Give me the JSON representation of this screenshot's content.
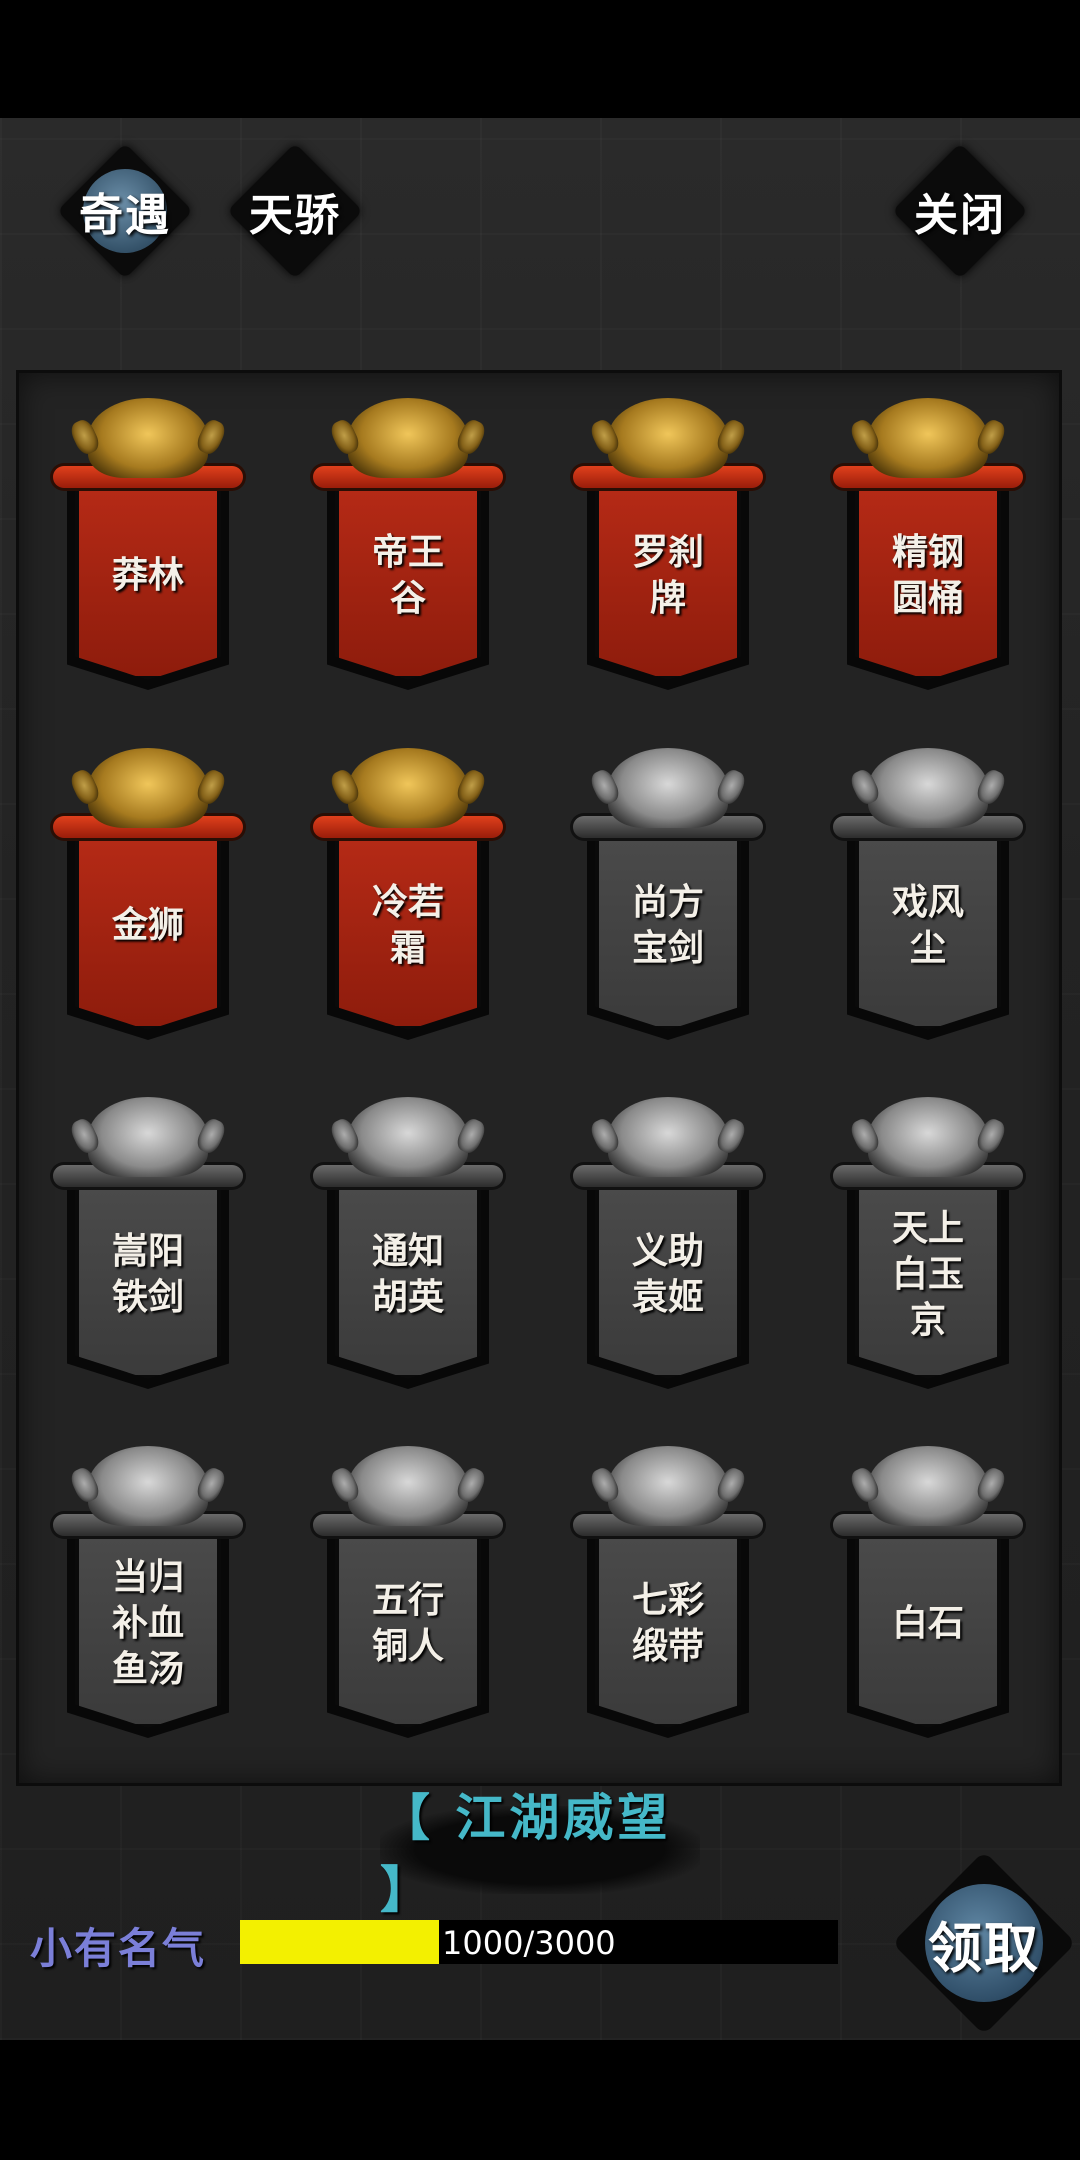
{
  "tabs": [
    {
      "label": "奇遇",
      "active": true
    },
    {
      "label": "天骄",
      "active": false
    }
  ],
  "close_label": "关闭",
  "items": [
    {
      "label": "莽林",
      "state": "unlocked"
    },
    {
      "label": "帝王谷",
      "state": "unlocked"
    },
    {
      "label": "罗刹牌",
      "state": "unlocked"
    },
    {
      "label": "精钢圆桶",
      "state": "unlocked"
    },
    {
      "label": "金狮",
      "state": "unlocked"
    },
    {
      "label": "冷若霜",
      "state": "unlocked"
    },
    {
      "label": "尚方宝剑",
      "state": "locked"
    },
    {
      "label": "戏风尘",
      "state": "locked"
    },
    {
      "label": "嵩阳铁剑",
      "state": "locked"
    },
    {
      "label": "通知胡英",
      "state": "locked"
    },
    {
      "label": "义助袁姬",
      "state": "locked"
    },
    {
      "label": "天上白玉京",
      "state": "locked"
    },
    {
      "label": "当归补血鱼汤",
      "state": "locked"
    },
    {
      "label": "五行铜人",
      "state": "locked"
    },
    {
      "label": "七彩缎带",
      "state": "locked"
    },
    {
      "label": "白石",
      "state": "locked"
    }
  ],
  "reputation": {
    "title": "【 江湖威望 】",
    "rank": "小有名气",
    "progress_text": "1000/3000",
    "current": 1000,
    "max": 3000
  },
  "claim_label": "领取",
  "colors": {
    "banner_red": "#b52a16",
    "banner_gray": "#4a4a4a",
    "progress_fill": "#f3f000",
    "title_cyan": "#45b8c8",
    "rank_purple": "#7b7fd8",
    "active_blue": "#4a6e88"
  }
}
